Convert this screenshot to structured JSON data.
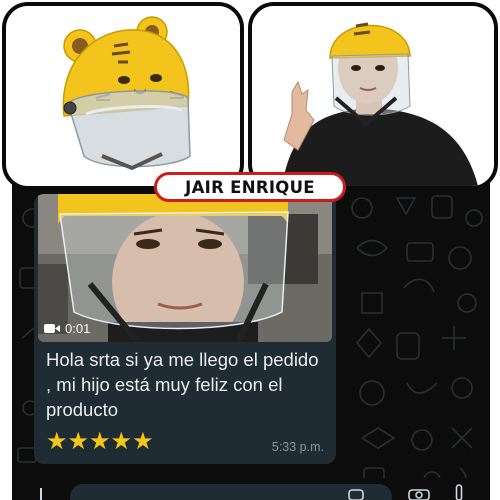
{
  "customer": {
    "name": "JAIR ENRIQUE"
  },
  "message": {
    "video_duration": "0:01",
    "text": "Hola srta si ya me llego el pedido , mi hijo está muy feliz con el producto",
    "stars": "★★★★★",
    "rating": 5,
    "time": "5:33 p.m."
  },
  "colors": {
    "helmet_yellow": "#f2c41c",
    "badge_border": "#d11a1a",
    "bubble_bg": "#1f2c33",
    "chat_bg": "#0c0c0c",
    "star": "#f5c518"
  },
  "icons": [
    "video-camera-icon",
    "camera-icon",
    "microphone-icon",
    "attach-icon"
  ]
}
